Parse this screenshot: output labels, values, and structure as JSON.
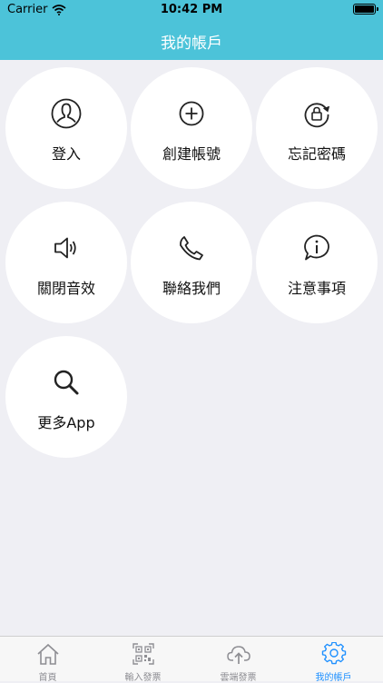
{
  "status_bar": {
    "carrier": "Carrier",
    "time": "10:42 PM"
  },
  "header": {
    "title": "我的帳戶"
  },
  "menu": [
    {
      "label": "登入",
      "icon": "user-icon"
    },
    {
      "label": "創建帳號",
      "icon": "plus-circle-icon"
    },
    {
      "label": "忘記密碼",
      "icon": "lock-reset-icon"
    },
    {
      "label": "關閉音效",
      "icon": "speaker-icon"
    },
    {
      "label": "聯絡我們",
      "icon": "phone-icon"
    },
    {
      "label": "注意事項",
      "icon": "info-icon"
    },
    {
      "label": "更多App",
      "icon": "search-icon"
    }
  ],
  "tabbar": [
    {
      "label": "首頁",
      "icon": "home-icon"
    },
    {
      "label": "輸入發票",
      "icon": "qr-code-icon"
    },
    {
      "label": "雲端發票",
      "icon": "cloud-upload-icon"
    },
    {
      "label": "我的帳戶",
      "icon": "gear-icon",
      "active": true
    }
  ],
  "colors": {
    "header": "#4cc3d9",
    "background": "#efeff4",
    "active_tab": "#1e90ff",
    "inactive_tab": "#8e8e93"
  }
}
